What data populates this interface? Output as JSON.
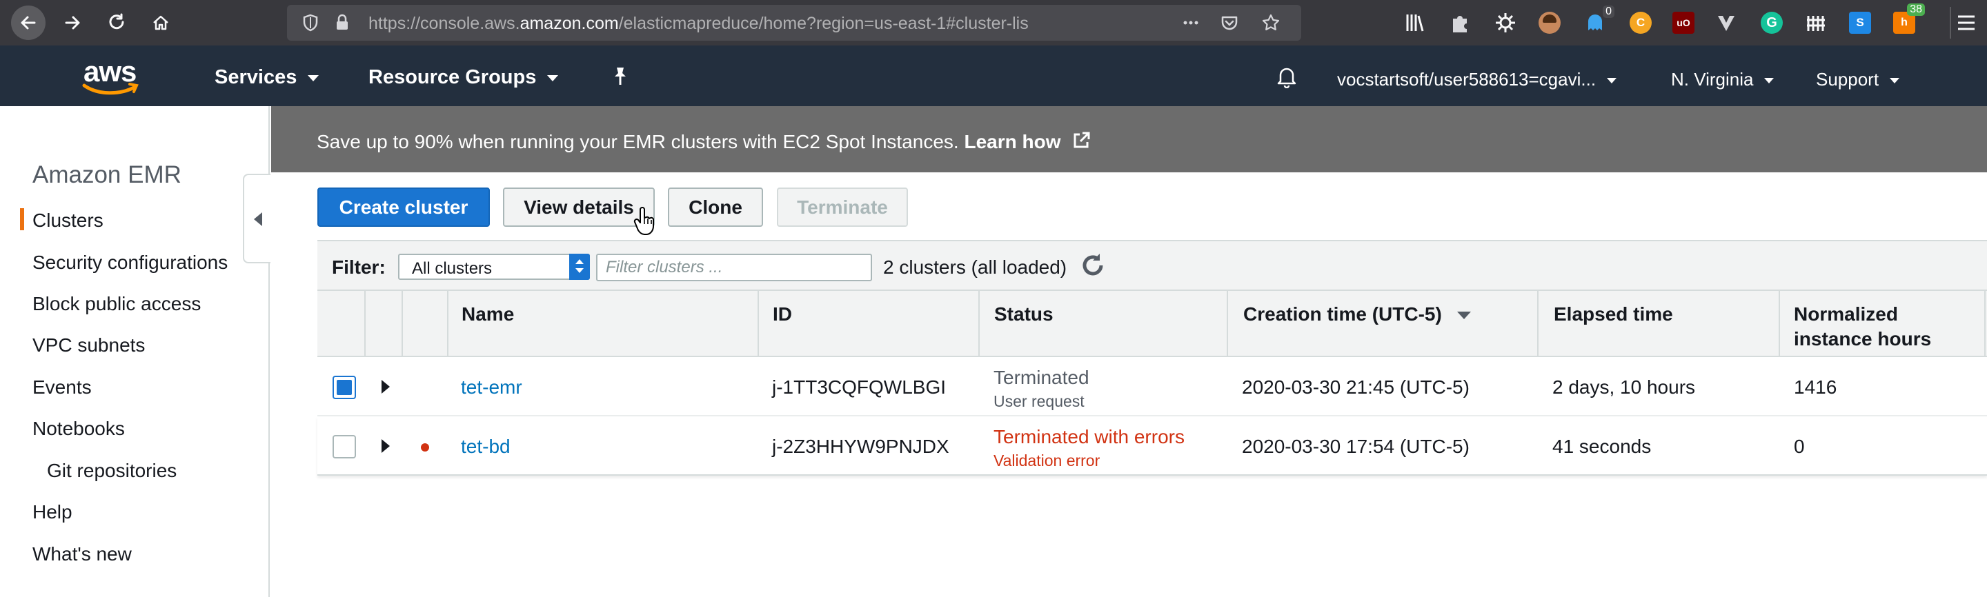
{
  "browser": {
    "url_prefix": "https://console.aws.",
    "url_domain": "amazon.com",
    "url_rest": "/elasticmapreduce/home?region=us-east-1#cluster-lis",
    "ext_badge_count": "0",
    "ext_badge_count2": "38",
    "ext_c_label": "C",
    "ext_ub_label": "uO",
    "ext_s_label": "S"
  },
  "header": {
    "logo_text": "aws",
    "services_label": "Services",
    "resource_groups_label": "Resource Groups",
    "account_label": "vocstartsoft/user588613=cgavi...",
    "region_label": "N. Virginia",
    "support_label": "Support"
  },
  "sidebar": {
    "title": "Amazon EMR",
    "items": [
      {
        "label": "Clusters",
        "active": true
      },
      {
        "label": "Security configurations"
      },
      {
        "label": "Block public access"
      },
      {
        "label": "VPC subnets"
      },
      {
        "label": "Events"
      },
      {
        "label": "Notebooks"
      },
      {
        "label": "Git repositories",
        "indent": true
      },
      {
        "label": "Help"
      },
      {
        "label": "What's new"
      }
    ]
  },
  "banner": {
    "text": "Save up to 90% when running your EMR clusters with EC2 Spot Instances. ",
    "link": "Learn how"
  },
  "toolbar": {
    "create_label": "Create cluster",
    "view_details_label": "View details",
    "clone_label": "Clone",
    "terminate_label": "Terminate"
  },
  "filter": {
    "label": "Filter:",
    "select_value": "All clusters",
    "placeholder": "Filter clusters ...",
    "count_text": "2 clusters (all loaded)"
  },
  "table": {
    "columns": [
      "Name",
      "ID",
      "Status",
      "Creation time (UTC-5)",
      "Elapsed time",
      "Normalized instance hours"
    ],
    "rows": [
      {
        "name": "tet-emr",
        "id": "j-1TT3CQFQWLBGI",
        "status": "Terminated",
        "status_detail": "User request",
        "creation_time": "2020-03-30 21:45 (UTC-5)",
        "elapsed": "2 days, 10 hours",
        "instance_hours": "1416",
        "checked": true
      },
      {
        "name": "tet-bd",
        "id": "j-2Z3HHYW9PNJDX",
        "status": "Terminated with errors",
        "status_detail": "Validation error",
        "creation_time": "2020-03-30 17:54 (UTC-5)",
        "elapsed": "41 seconds",
        "instance_hours": "0",
        "checked": false
      }
    ]
  },
  "colors": {
    "accent": "#ec7211",
    "primary_button": "#1a75d1",
    "link": "#0073bb",
    "error": "#d13212",
    "header_bg": "#232f3e"
  }
}
